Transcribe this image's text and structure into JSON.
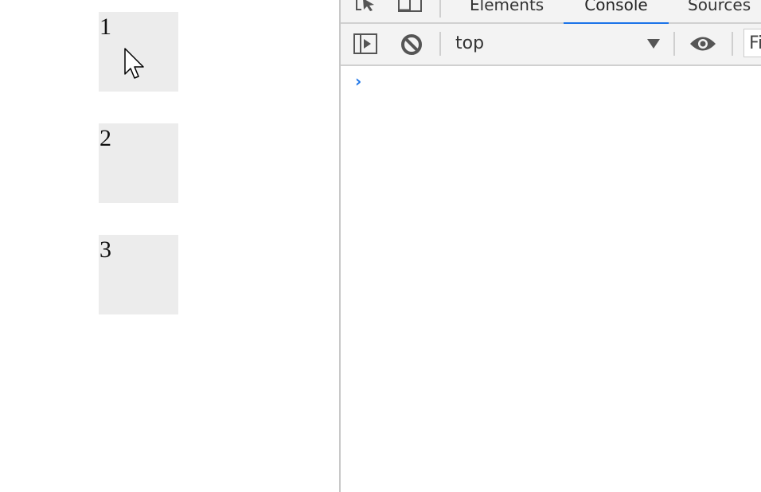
{
  "page": {
    "boxes": [
      "1",
      "2",
      "3"
    ]
  },
  "devtools": {
    "tabs": [
      {
        "label": "Elements",
        "active": false
      },
      {
        "label": "Console",
        "active": true
      },
      {
        "label": "Sources",
        "active": false
      }
    ],
    "toolbar": {
      "context_value": "top",
      "filter_placeholder": "Filter"
    },
    "console": {
      "prompt_symbol": "›"
    },
    "colors": {
      "accent": "#1a73e8",
      "panel_bg": "#f3f3f3",
      "box_bg": "#ececec"
    }
  }
}
